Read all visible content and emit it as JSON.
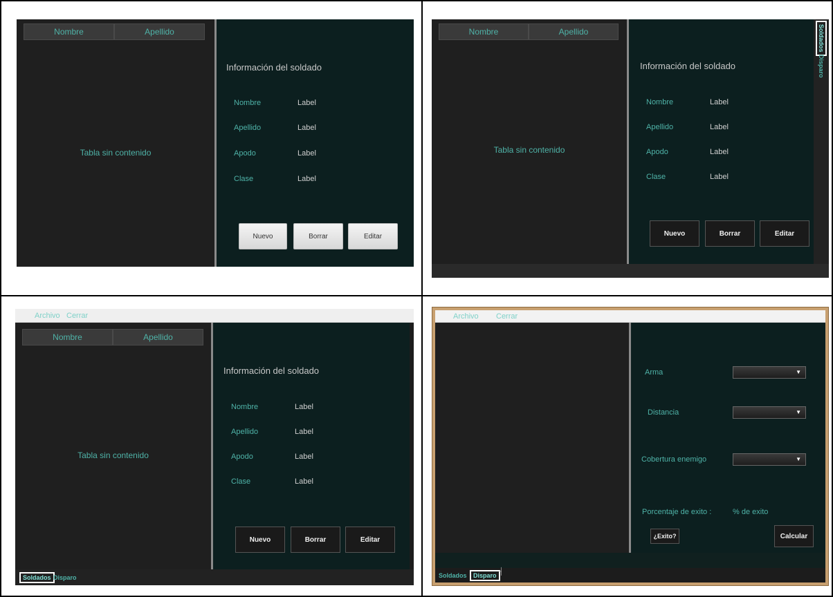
{
  "quadrants": {
    "q1": {
      "table": {
        "columns": [
          "Nombre",
          "Apellido"
        ],
        "empty": "Tabla sin contenido"
      },
      "info": {
        "title": "Información del soldado",
        "fields": [
          {
            "label": "Nombre",
            "value": "Label"
          },
          {
            "label": "Apellido",
            "value": "Label"
          },
          {
            "label": "Apodo",
            "value": "Label"
          },
          {
            "label": "Clase",
            "value": "Label"
          }
        ],
        "buttons": [
          "Nuevo",
          "Borrar",
          "Editar"
        ]
      }
    },
    "q2": {
      "table": {
        "columns": [
          "Nombre",
          "Apellido"
        ],
        "empty": "Tabla sin contenido"
      },
      "info": {
        "title": "Información del soldado",
        "fields": [
          {
            "label": "Nombre",
            "value": "Label"
          },
          {
            "label": "Apellido",
            "value": "Label"
          },
          {
            "label": "Apodo",
            "value": "Label"
          },
          {
            "label": "Clase",
            "value": "Label"
          }
        ],
        "buttons": [
          "Nuevo",
          "Borrar",
          "Editar"
        ]
      },
      "vtabs": [
        "Soldados",
        "Disparo"
      ]
    },
    "q3": {
      "menu": [
        "Archivo",
        "Cerrar"
      ],
      "table": {
        "columns": [
          "Nombre",
          "Apellido"
        ],
        "empty": "Tabla sin contenido"
      },
      "info": {
        "title": "Información del soldado",
        "fields": [
          {
            "label": "Nombre",
            "value": "Label"
          },
          {
            "label": "Apellido",
            "value": "Label"
          },
          {
            "label": "Apodo",
            "value": "Label"
          },
          {
            "label": "Clase",
            "value": "Label"
          }
        ],
        "buttons": [
          "Nuevo",
          "Borrar",
          "Editar"
        ]
      },
      "tabs": [
        "Soldados",
        "Disparo"
      ]
    },
    "q4": {
      "menu": [
        "Archivo",
        "Cerrar"
      ],
      "form": {
        "arma": "Arma",
        "distancia": "Distancia",
        "cobertura": "Cobertura enemigo",
        "porcentaje_label": "Porcentaje de exito :",
        "porcentaje_value": "% de exito",
        "exito_button": "¿Exito?",
        "calcular_button": "Calcular"
      },
      "tabs": [
        "Soldados",
        "Disparo"
      ]
    }
  },
  "colors": {
    "accent": "#4fb3a8",
    "panel": "#0c1f1f",
    "background": "#1f1f1f",
    "border_q4": "#c8a070"
  }
}
